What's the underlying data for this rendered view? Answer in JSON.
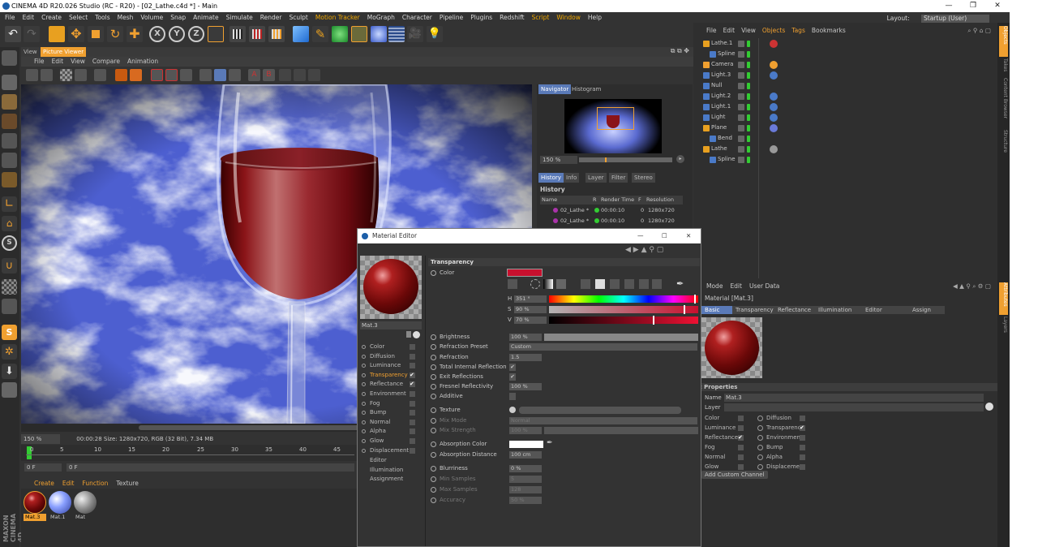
{
  "window": {
    "title": "CINEMA 4D R20.026 Studio (RC - R20) - [02_Lathe.c4d *] - Main",
    "minimize": "—",
    "maximize": "❐",
    "close": "✕"
  },
  "menubar": {
    "items": [
      "File",
      "Edit",
      "Create",
      "Select",
      "Tools",
      "Mesh",
      "Volume",
      "Snap",
      "Animate",
      "Simulate",
      "Render",
      "Sculpt",
      "Motion Tracker",
      "MoGraph",
      "Character",
      "Pipeline",
      "Plugins",
      "Redshift",
      "Script",
      "Window",
      "Help"
    ],
    "highlighted": [
      "Motion Tracker",
      "Script",
      "Window"
    ],
    "layout_label": "Layout:",
    "layout_value": "Startup (User)"
  },
  "picture_viewer": {
    "tabs": [
      "View",
      "Picture Viewer"
    ],
    "menu": [
      "File",
      "Edit",
      "View",
      "Compare",
      "Animation"
    ],
    "zoom": "150 %",
    "status": "00:00:28   Size: 1280x720, RGB (32 Bit), 7.34 MB",
    "timeline_ticks": [
      "0",
      "5",
      "10",
      "15",
      "20",
      "25",
      "30",
      "35",
      "40",
      "45"
    ],
    "frame_start": "0 F",
    "frame_end": "0 F"
  },
  "navigator": {
    "tabs": [
      "Navigator",
      "Histogram"
    ],
    "zoom": "150 %"
  },
  "history": {
    "tabs": [
      "History",
      "Info",
      "Layer",
      "Filter",
      "Stereo"
    ],
    "title": "History",
    "columns": [
      "Name",
      "R",
      "Render Time",
      "F",
      "Resolution"
    ],
    "rows": [
      {
        "name": "02_Lathe *",
        "time": "00:00:10",
        "f": "0",
        "res": "1280x720"
      },
      {
        "name": "02_Lathe *",
        "time": "00:00:10",
        "f": "0",
        "res": "1280x720"
      }
    ]
  },
  "material_manager": {
    "menu": [
      "Create",
      "Edit",
      "Function",
      "Texture"
    ],
    "materials": [
      "Mat.3",
      "Mat.1",
      "Mat"
    ]
  },
  "objects": {
    "menu": [
      "File",
      "Edit",
      "View",
      "Objects",
      "Tags",
      "Bookmarks"
    ],
    "items": [
      {
        "name": "Lathe.1",
        "indent": 0
      },
      {
        "name": "Spline",
        "indent": 1
      },
      {
        "name": "Camera",
        "indent": 0
      },
      {
        "name": "Light.3",
        "indent": 0
      },
      {
        "name": "Null",
        "indent": 0
      },
      {
        "name": "Light.2",
        "indent": 0
      },
      {
        "name": "Light.1",
        "indent": 0
      },
      {
        "name": "Light",
        "indent": 0
      },
      {
        "name": "Plane",
        "indent": 0
      },
      {
        "name": "Bend",
        "indent": 1
      },
      {
        "name": "Lathe",
        "indent": 0
      },
      {
        "name": "Spline",
        "indent": 1
      }
    ]
  },
  "attributes": {
    "menu": [
      "Mode",
      "Edit",
      "User Data"
    ],
    "title": "Material [Mat.3]",
    "tabs": [
      "Basic",
      "Transparency",
      "Reflectance",
      "Illumination",
      "Editor",
      "Assign"
    ],
    "section": "sic Properties",
    "name_label": "Name",
    "name_value": "Mat.3",
    "layer_label": "Layer",
    "channels_left": [
      {
        "label": "Color",
        "checked": false
      },
      {
        "label": "Luminance",
        "checked": false
      },
      {
        "label": "Reflectance",
        "checked": true
      },
      {
        "label": "Fog",
        "checked": false
      },
      {
        "label": "Normal",
        "checked": false
      },
      {
        "label": "Glow",
        "checked": false
      }
    ],
    "channels_right": [
      {
        "label": "Diffusion",
        "checked": false
      },
      {
        "label": "Transparency",
        "checked": true
      },
      {
        "label": "Environment",
        "checked": false
      },
      {
        "label": "Bump",
        "checked": false
      },
      {
        "label": "Alpha",
        "checked": false
      },
      {
        "label": "Displacement",
        "checked": false
      }
    ],
    "add_channel": "Add Custom Channel"
  },
  "right_strip": [
    "Objects",
    "Takes",
    "Content Browser",
    "Structure",
    "Attributes",
    "Layers"
  ],
  "material_editor": {
    "title": "Material Editor",
    "mat_name": "Mat.3",
    "channels": [
      {
        "label": "Color",
        "checked": false,
        "active": false
      },
      {
        "label": "Diffusion",
        "checked": false,
        "active": false
      },
      {
        "label": "Luminance",
        "checked": false,
        "active": false
      },
      {
        "label": "Transparency",
        "checked": true,
        "active": true
      },
      {
        "label": "Reflectance",
        "checked": true,
        "active": false
      },
      {
        "label": "Environment",
        "checked": false,
        "active": false
      },
      {
        "label": "Fog",
        "checked": false,
        "active": false
      },
      {
        "label": "Bump",
        "checked": false,
        "active": false
      },
      {
        "label": "Normal",
        "checked": false,
        "active": false
      },
      {
        "label": "Alpha",
        "checked": false,
        "active": false
      },
      {
        "label": "Glow",
        "checked": false,
        "active": false
      },
      {
        "label": "Displacement",
        "checked": false,
        "active": false
      }
    ],
    "extras": [
      "Editor",
      "Illumination",
      "Assignment"
    ],
    "section": "Transparency",
    "color_label": "Color",
    "color_value": "#c8102e",
    "h_label": "H",
    "h_value": "351 °",
    "s_label": "S",
    "s_value": "90 %",
    "v_label": "V",
    "v_value": "70 %",
    "props": {
      "brightness": {
        "label": "Brightness",
        "value": "100 %"
      },
      "refraction_preset": {
        "label": "Refraction Preset",
        "value": "Custom"
      },
      "refraction": {
        "label": "Refraction",
        "value": "1.5"
      },
      "tir": {
        "label": "Total Internal Reflection",
        "value": "✔"
      },
      "exit_refl": {
        "label": "Exit Reflections",
        "value": "✔"
      },
      "fresnel": {
        "label": "Fresnel Reflectivity",
        "value": "100 %"
      },
      "additive": {
        "label": "Additive",
        "value": ""
      },
      "texture": {
        "label": "Texture",
        "value": "..."
      },
      "mix_mode": {
        "label": "Mix Mode",
        "value": "Normal"
      },
      "mix_strength": {
        "label": "Mix Strength",
        "value": "100 %"
      },
      "absorption_color": {
        "label": "Absorption Color",
        "value": ""
      },
      "absorption_distance": {
        "label": "Absorption Distance",
        "value": "100 cm"
      },
      "blurriness": {
        "label": "Blurriness",
        "value": "0 %"
      },
      "min_samples": {
        "label": "Min Samples",
        "value": "5"
      },
      "max_samples": {
        "label": "Max Samples",
        "value": "128"
      },
      "accuracy": {
        "label": "Accuracy",
        "value": "50 %"
      }
    }
  },
  "colors": {
    "accent": "#f0a030",
    "panel": "#333333",
    "red": "#c8102e",
    "highlight_tab": "#5a7ab8"
  }
}
